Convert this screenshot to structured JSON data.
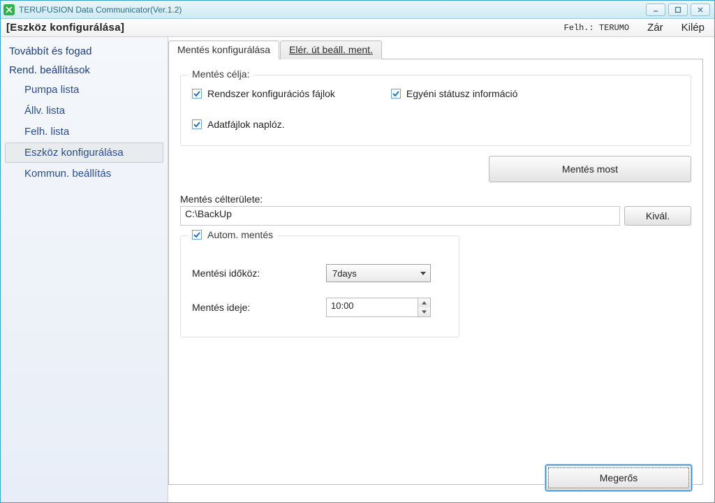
{
  "window": {
    "title": "TERUFUSION Data Communicator(Ver.1.2)"
  },
  "header": {
    "page_title": "[Eszköz konfigurálása]",
    "user_prefix": "Felh.:",
    "user_name": "TERUMO",
    "close_label": "Zár",
    "exit_label": "Kilép"
  },
  "sidebar": {
    "cat1": "Továbbít és fogad",
    "cat2": "Rend. beállítások",
    "items": {
      "pump": "Pumpa lista",
      "allv": "Állv. lista",
      "felh": "Felh. lista",
      "devcfg": "Eszköz konfigurálása",
      "comm": "Kommun. beállítás"
    }
  },
  "tabs": {
    "save_cfg": "Mentés konfigurálása",
    "path_cfg": "Elér. út beáll. ment."
  },
  "group_target": {
    "legend": "Mentés célja:",
    "chk_sysfiles": "Rendszer konfigurációs fájlok",
    "chk_custom": "Egyéni státusz információ",
    "chk_logdata": "Adatfájlok naplóz."
  },
  "buttons": {
    "save_now": "Mentés most",
    "browse": "Kivál.",
    "confirm": "Megerős"
  },
  "dest": {
    "label": "Mentés célterülete:",
    "path": "C:\\BackUp"
  },
  "auto": {
    "legend_chk": "Autom. mentés",
    "interval_label": "Mentési időköz:",
    "interval_value": "7days",
    "time_label": "Mentés ideje:",
    "time_value": "10:00"
  }
}
